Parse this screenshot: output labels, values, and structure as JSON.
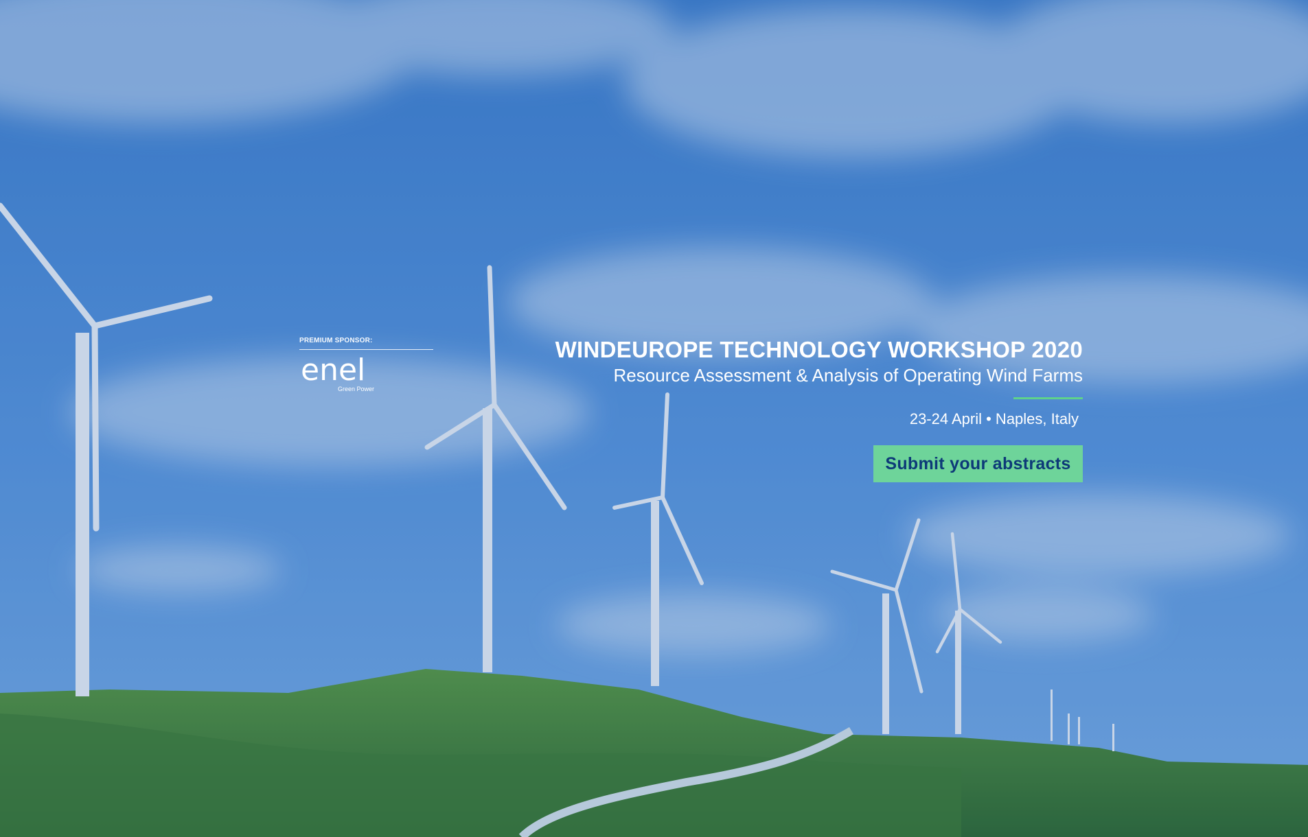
{
  "sponsor": {
    "label": "PREMIUM SPONSOR:",
    "logo_name": "enel",
    "logo_tagline": "Green Power"
  },
  "event": {
    "title": "WINDEUROPE TECHNOLOGY WORKSHOP 2020",
    "subtitle": "Resource Assessment & Analysis of Operating Wind Farms",
    "date_location": "23-24 April • Naples, Italy",
    "cta_label": "Submit your abstracts"
  },
  "colors": {
    "sky": "#4f8ed6",
    "accent_green": "#6ed49a",
    "cta_text": "#0d3a78"
  },
  "icons": {
    "turbine": "wind-turbine-icon",
    "logo": "enel-logo-icon"
  }
}
